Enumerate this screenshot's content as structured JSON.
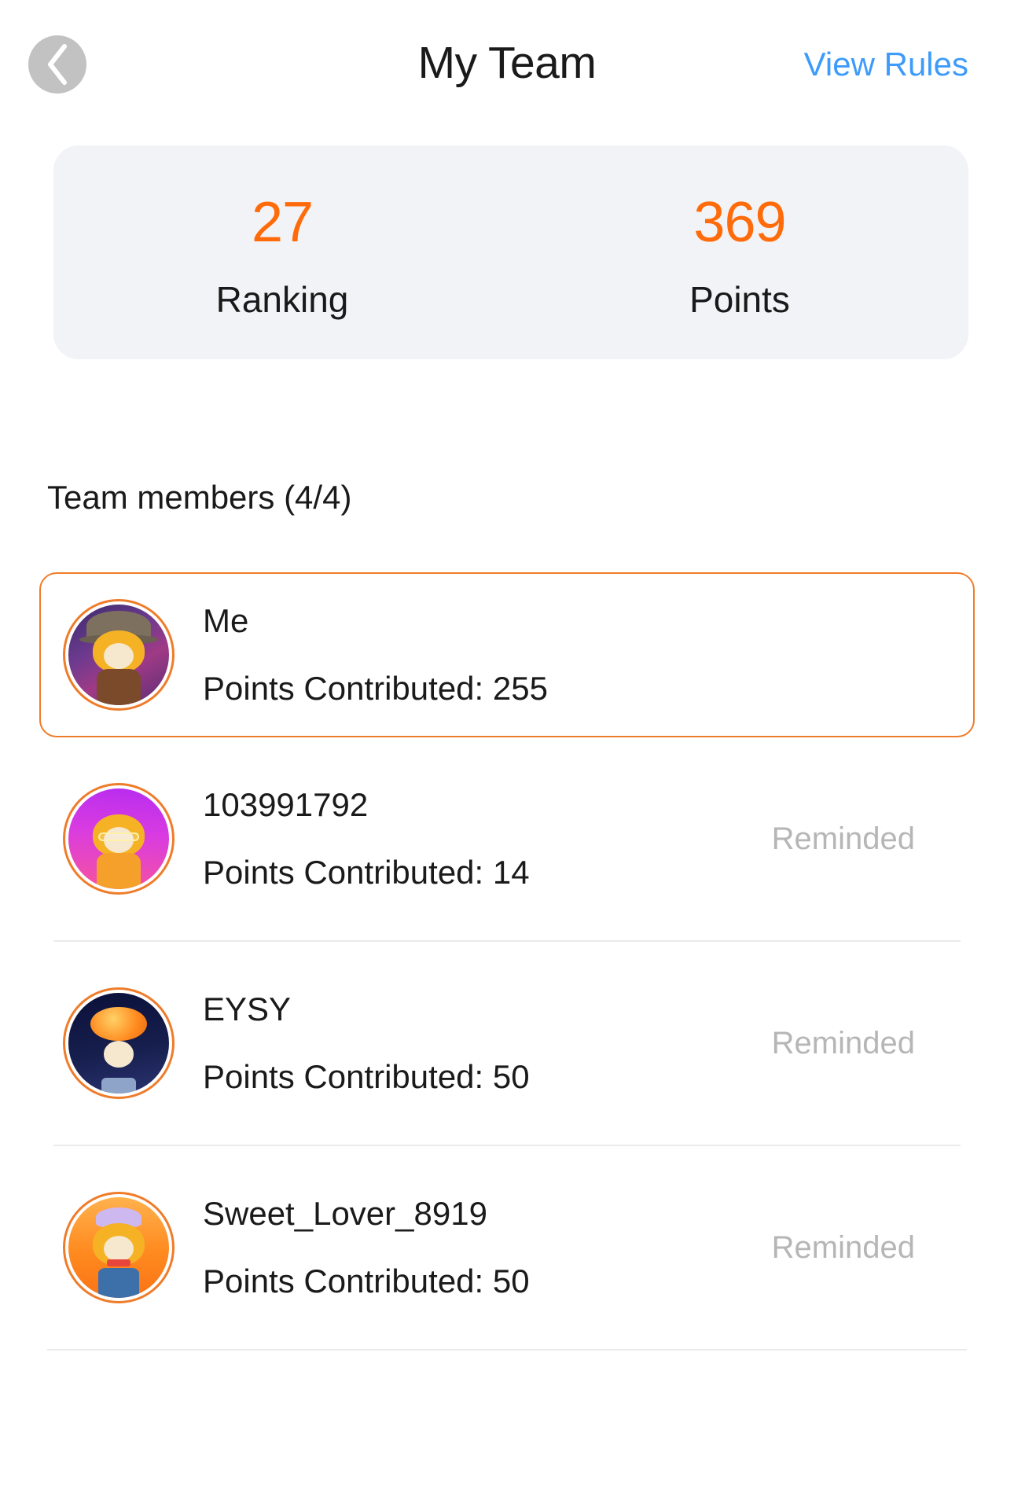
{
  "header": {
    "title": "My Team",
    "back_icon": "chevron-left-icon",
    "view_rules_label": "View Rules"
  },
  "colors": {
    "accent_orange": "#FF6B0A",
    "border_orange": "#EF7C2A",
    "link_blue": "#3D9BFB",
    "card_bg": "#F2F3F7",
    "muted_text": "#B6B6B6",
    "divider": "#EBEBEB"
  },
  "stats": {
    "ranking": {
      "value": "27",
      "label": "Ranking"
    },
    "points": {
      "value": "369",
      "label": "Points"
    }
  },
  "team": {
    "section_title": "Team members (4/4)",
    "members": [
      {
        "name": "Me",
        "points_text": "Points Contributed: 255",
        "points": 255,
        "status": "",
        "highlighted": true,
        "avatar": "avatar-witch-night"
      },
      {
        "name": "103991792",
        "points_text": "Points Contributed: 14",
        "points": 14,
        "status": "Reminded",
        "highlighted": false,
        "avatar": "avatar-glasses-pink"
      },
      {
        "name": "EYSY",
        "points_text": "Points Contributed: 50",
        "points": 50,
        "status": "Reminded",
        "highlighted": false,
        "avatar": "avatar-pumpkin-space"
      },
      {
        "name": "Sweet_Lover_8919",
        "points_text": "Points Contributed: 50",
        "points": 50,
        "status": "Reminded",
        "highlighted": false,
        "avatar": "avatar-chef-orange"
      }
    ]
  }
}
